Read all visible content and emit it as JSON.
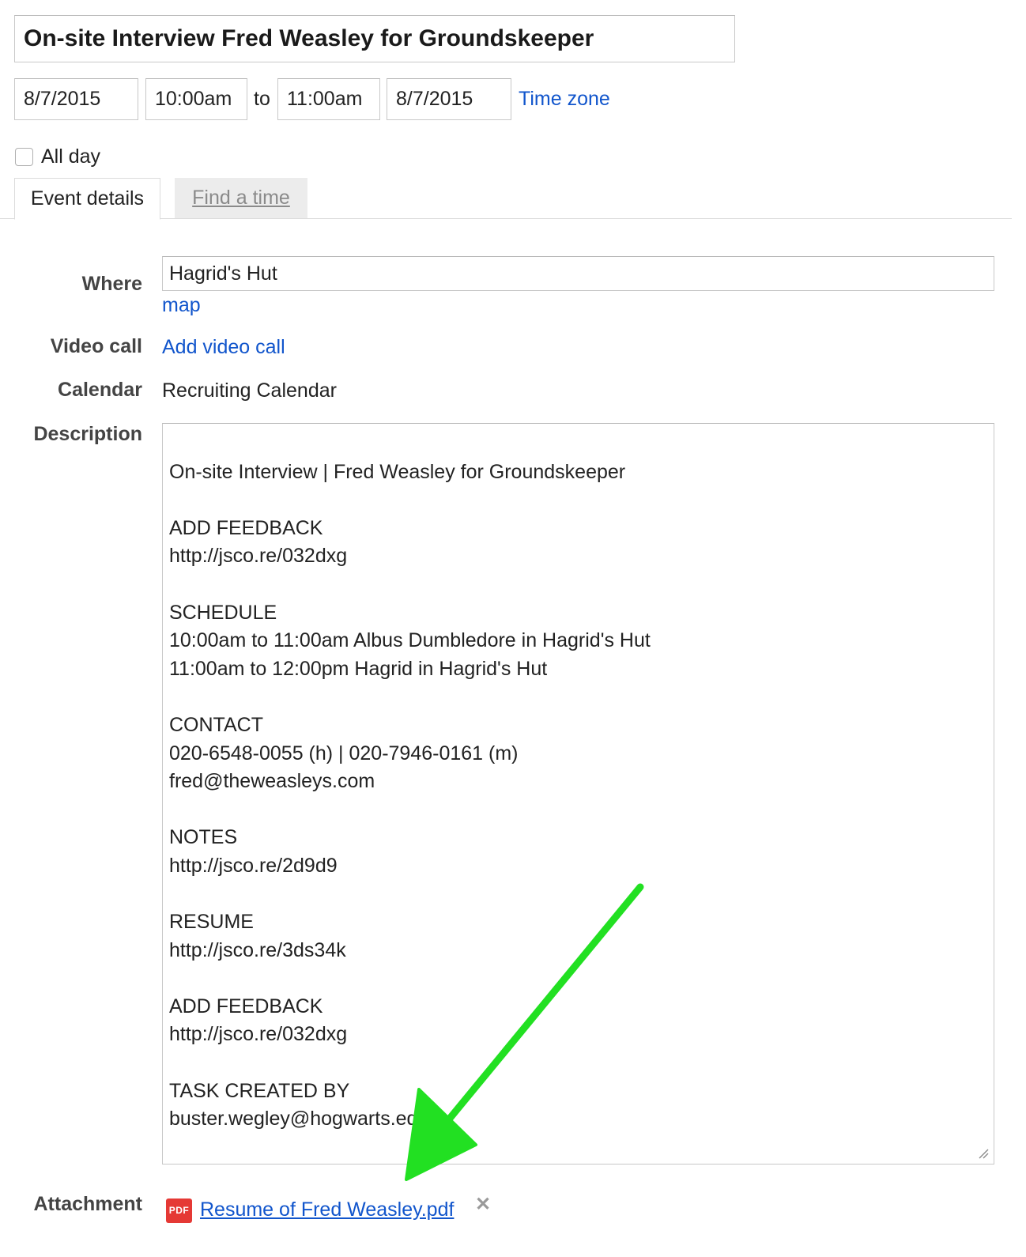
{
  "event": {
    "title": "On-site Interview Fred Weasley for Groundskeeper",
    "start_date": "8/7/2015",
    "start_time": "10:00am",
    "to_label": "to",
    "end_time": "11:00am",
    "end_date": "8/7/2015",
    "time_zone_link": "Time zone",
    "all_day_label": "All day",
    "all_day_checked": false
  },
  "tabs": [
    {
      "label": "Event details",
      "active": true
    },
    {
      "label": "Find a time",
      "active": false
    }
  ],
  "details": {
    "where_label": "Where",
    "where_value": "Hagrid's Hut",
    "map_link": "map",
    "video_label": "Video call",
    "video_link": "Add video call",
    "calendar_label": "Calendar",
    "calendar_value": "Recruiting Calendar",
    "description_label": "Description",
    "description_text": "On-site Interview | Fred Weasley for Groundskeeper\n\nADD FEEDBACK\nhttp://jsco.re/032dxg\n\nSCHEDULE\n10:00am to 11:00am Albus Dumbledore in Hagrid's Hut\n11:00am to 12:00pm Hagrid in Hagrid's Hut\n\nCONTACT\n020-6548-0055 (h) | 020-7946-0161 (m)\nfred@theweasleys.com\n\nNOTES\nhttp://jsco.re/2d9d9\n\nRESUME\nhttp://jsco.re/3ds34k\n\nADD FEEDBACK\nhttp://jsco.re/032dxg\n\nTASK CREATED BY\nbuster.wegley@hogwarts.edu",
    "attachment_label": "Attachment",
    "attachment_icon_text": "PDF",
    "attachment_file": "Resume of Fred Weasley.pdf"
  },
  "icons": {
    "remove": "close-icon",
    "file": "pdf-icon",
    "annotation": "arrow-icon"
  },
  "colors": {
    "link": "#1155cc",
    "arrow": "#22e022",
    "pdf": "#e53935"
  }
}
